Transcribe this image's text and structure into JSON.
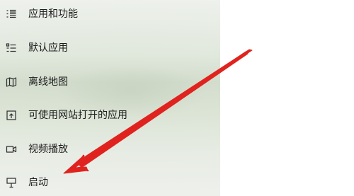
{
  "nav": {
    "items": [
      {
        "label": "应用和功能",
        "icon": "apps-features-icon"
      },
      {
        "label": "默认应用",
        "icon": "default-apps-icon"
      },
      {
        "label": "离线地图",
        "icon": "offline-maps-icon"
      },
      {
        "label": "可使用网站打开的应用",
        "icon": "apps-for-websites-icon"
      },
      {
        "label": "视频播放",
        "icon": "video-playback-icon"
      },
      {
        "label": "启动",
        "icon": "startup-icon"
      }
    ]
  },
  "colors": {
    "arrow": "#e0231f",
    "text": "#1b1b1b",
    "icon": "#2b2b2b"
  }
}
